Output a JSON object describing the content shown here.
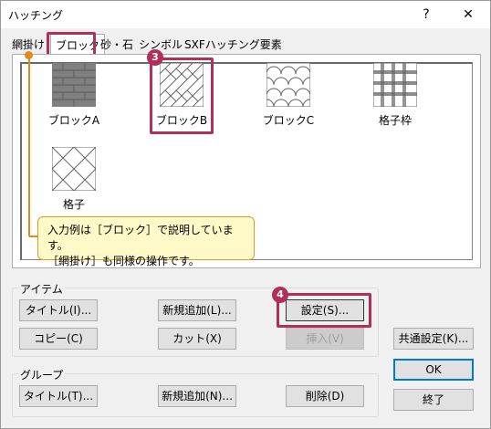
{
  "window": {
    "title": "ハッチング",
    "help_glyph": "?",
    "close_glyph": "✕"
  },
  "tabs": [
    {
      "label": "網掛け"
    },
    {
      "label": "ブロック"
    },
    {
      "label": "砂・石"
    },
    {
      "label": "シンボル"
    },
    {
      "label": "SXFハッチング要素"
    }
  ],
  "patterns": [
    {
      "label": "ブロックA",
      "icon": "brick-pattern-icon"
    },
    {
      "label": "ブロックB",
      "icon": "herringbone-pattern-icon"
    },
    {
      "label": "ブロックC",
      "icon": "scale-pattern-icon"
    },
    {
      "label": "格子枠",
      "icon": "grid-frame-pattern-icon"
    },
    {
      "label": "格子",
      "icon": "diagonal-lattice-pattern-icon"
    }
  ],
  "callouts": {
    "step3": "3",
    "step4": "4"
  },
  "tooltip": {
    "line1": "入力例は［ブロック］で説明しています。",
    "line2": "［網掛け］も同様の操作です。"
  },
  "item_group": {
    "label": "アイテム",
    "title_button": "タイトル(I)...",
    "add_button": "新規追加(L)...",
    "settings_button": "設定(S)...",
    "copy_button": "コピー(C)",
    "cut_button": "カット(X)",
    "insert_button": "挿入(V)"
  },
  "group_group": {
    "label": "グループ",
    "title_button": "タイトル(T)...",
    "add_button": "新規追加(N)...",
    "delete_button": "削除(D)"
  },
  "side_buttons": {
    "common_settings": "共通設定(K)...",
    "ok": "OK",
    "exit": "終了"
  },
  "colors": {
    "highlight": "#b0305a",
    "tooltip_border": "#e39a2a",
    "tooltip_bg": "#fff9c8",
    "pointer": "#e08a1e"
  }
}
